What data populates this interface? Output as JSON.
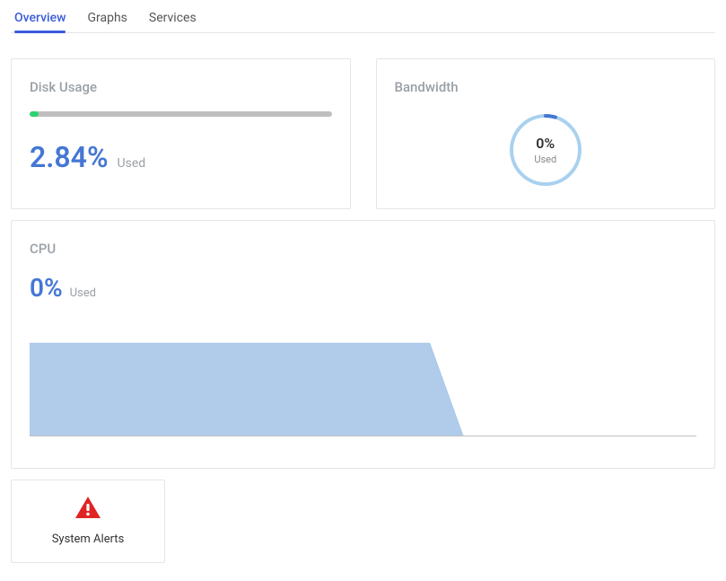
{
  "tabs": [
    {
      "label": "Overview",
      "active": true
    },
    {
      "label": "Graphs",
      "active": false
    },
    {
      "label": "Services",
      "active": false
    }
  ],
  "disk": {
    "title": "Disk Usage",
    "percent": "2.84%",
    "percent_value": 2.84,
    "used_label": "Used"
  },
  "bandwidth": {
    "title": "Bandwidth",
    "percent": "0%",
    "used_label": "Used"
  },
  "cpu": {
    "title": "CPU",
    "percent": "0%",
    "used_label": "Used"
  },
  "alerts": {
    "label": "System Alerts"
  },
  "colors": {
    "accent": "#4577d4",
    "progress_green": "#2dd36f",
    "donut_ring": "#a9d1ef",
    "chart_fill": "#a8c7e8",
    "alert_red": "#e02424"
  },
  "chart_data": {
    "type": "area",
    "series": [
      {
        "name": "CPU",
        "values": [
          100,
          100,
          100,
          100,
          100,
          100,
          100,
          100,
          100,
          100,
          100,
          100,
          100,
          0,
          0,
          0,
          0,
          0,
          0,
          0,
          0
        ]
      }
    ],
    "ylim": [
      0,
      100
    ],
    "xlabel": "",
    "ylabel": "",
    "title": ""
  }
}
